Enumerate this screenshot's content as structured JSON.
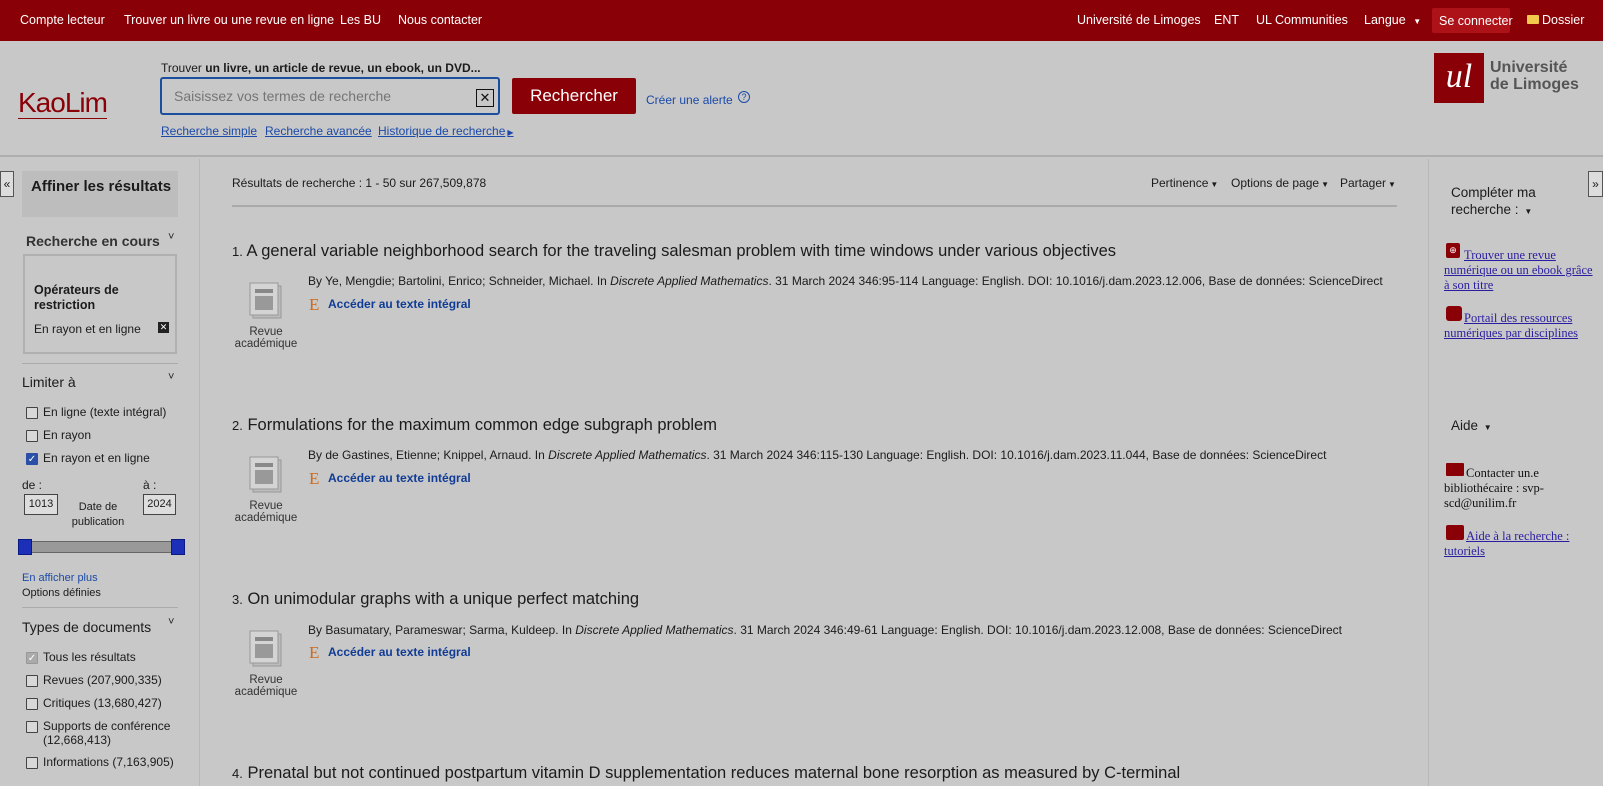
{
  "topbar": {
    "left": [
      "Compte lecteur",
      "Trouver un livre ou une revue en ligne",
      "Les BU",
      "Nous contacter"
    ],
    "right": [
      "Université de Limoges",
      "ENT",
      "UL Communities"
    ],
    "langue": "Langue",
    "login": "Se connecter",
    "dossier": "Dossier"
  },
  "header": {
    "logo": "KaoLim",
    "trouver_prefix": "Trouver ",
    "trouver_bold": "un livre, un article de revue, un ebook, un DVD...",
    "search_placeholder": "Saisissez vos termes de recherche",
    "search_value": "",
    "search_button": "Rechercher",
    "alert_link": "Créer une alerte",
    "links": [
      "Recherche simple",
      "Recherche avancée",
      "Historique de recherche"
    ],
    "univ_logo_text": [
      "Université",
      "de Limoges"
    ]
  },
  "left": {
    "collapse": "«",
    "affiner": "Affiner les résultats",
    "recherche_en_cours": "Recherche en cours",
    "operateurs": "Opérateurs de restriction",
    "operateur_value": "En rayon et en ligne",
    "limiter": "Limiter à",
    "limit_items": [
      {
        "label": "En ligne (texte intégral)",
        "checked": false
      },
      {
        "label": "En rayon",
        "checked": false
      },
      {
        "label": "En rayon et en ligne",
        "checked": true
      }
    ],
    "de_label": "de :",
    "a_label": "à :",
    "de_value": "1013",
    "a_value": "2024",
    "date_label": "Date de publication",
    "show_more": "En afficher plus",
    "options": "Options définies",
    "types_head": "Types de documents",
    "types": [
      {
        "label": "Tous les résultats",
        "state": "disabled"
      },
      {
        "label": "Revues (207,900,335)",
        "state": "off"
      },
      {
        "label": "Critiques (13,680,427)",
        "state": "off"
      },
      {
        "label": "Supports de conférence (12,668,413)",
        "state": "off"
      },
      {
        "label": "Informations (7,163,905)",
        "state": "off"
      }
    ]
  },
  "results": {
    "summary_prefix": "Résultats de recherche : ",
    "summary_value": "1 - 50 sur 267,509,878",
    "sort": "Pertinence",
    "page_options": "Options de page",
    "share": "Partager",
    "doc_type": "Revue académique",
    "fulltext": "Accéder au texte intégral",
    "items": [
      {
        "num": "1.",
        "title": "A general variable neighborhood search for the traveling salesman problem with time windows under various objectives",
        "by": "By Ye, Mengdie; Bartolini, Enrico; Schneider, Michael. In ",
        "journal": "Discrete Applied Mathematics",
        "rest": ". 31 March 2024 346:95-114 Language: English. DOI: 10.1016/j.dam.2023.12.006, Base de données: ScienceDirect"
      },
      {
        "num": "2.",
        "title": "Formulations for the maximum common edge subgraph problem",
        "by": "By de Gastines, Etienne; Knippel, Arnaud. In ",
        "journal": "Discrete Applied Mathematics",
        "rest": ". 31 March 2024 346:115-130 Language: English. DOI: 10.1016/j.dam.2023.11.044, Base de données: ScienceDirect"
      },
      {
        "num": "3.",
        "title": "On unimodular graphs with a unique perfect matching",
        "by": "By Basumatary, Parameswar; Sarma, Kuldeep. In ",
        "journal": "Discrete Applied Mathematics",
        "rest": ". 31 March 2024 346:49-61 Language: English. DOI: 10.1016/j.dam.2023.12.008, Base de données: ScienceDirect"
      },
      {
        "num": "4.",
        "title": "Prenatal but not continued postpartum vitamin D supplementation reduces maternal bone resorption as measured by C-terminal"
      }
    ]
  },
  "right": {
    "expand": "»",
    "completer": "Compléter ma recherche :",
    "link1": "Trouver une revue numérique ou un ebook grâce à son titre",
    "link2": "Portail des ressources numériques par disciplines",
    "aide": "Aide",
    "contact": "Contacter un.e bibliothécaire : svp-scd@unilim.fr",
    "tutoriels": "Aide à la recherche : tutoriels"
  },
  "colors": {
    "brand": "#8a0007",
    "link": "#1b4aa8",
    "fulltext_icon": "#d06a1a"
  }
}
